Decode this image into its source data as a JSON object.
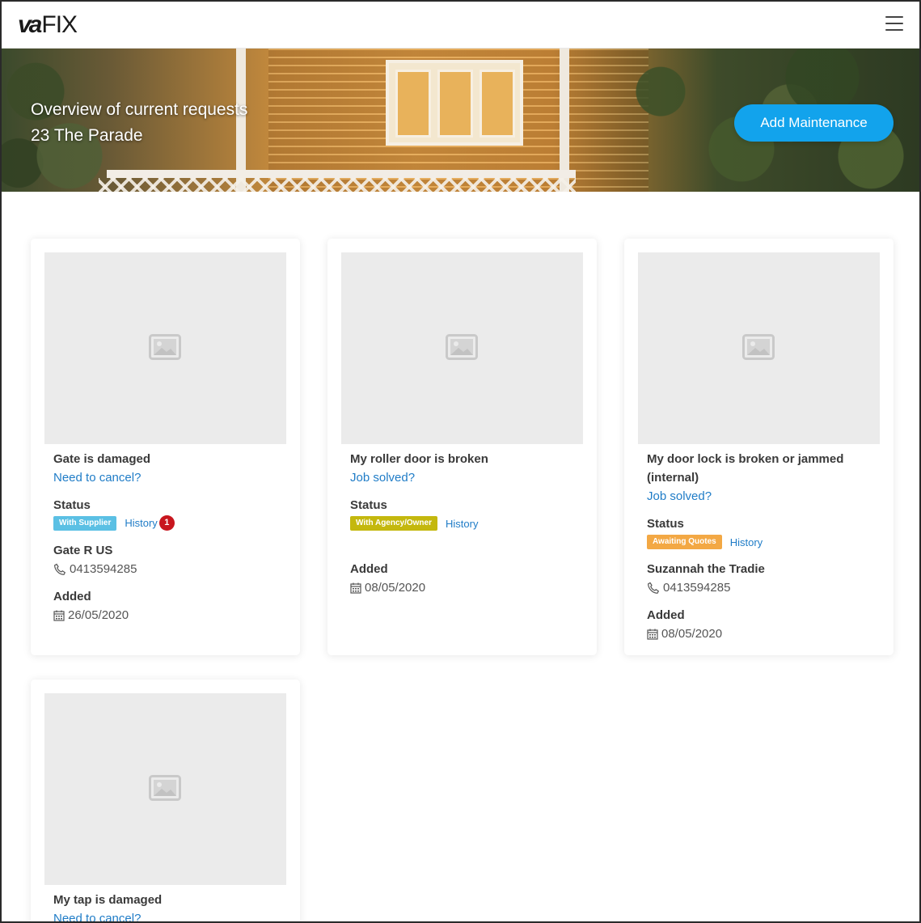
{
  "header": {
    "logo_bold": "va",
    "logo_light": "FIX",
    "menu_icon": "hamburger-icon"
  },
  "hero": {
    "title_line1": "Overview of current requests",
    "title_line2": "23 The Parade",
    "add_button_label": "Add Maintenance",
    "accent_color": "#12a3ec"
  },
  "cards": [
    {
      "title": "Gate is damaged",
      "action_link": "Need to cancel?",
      "status_label": "Status",
      "status_badge": "With Supplier",
      "status_color": "#5bc0e4",
      "history_label": "History",
      "history_count": "1",
      "supplier_name": "Gate R US",
      "phone": "0413594285",
      "added_label": "Added",
      "added_date": "26/05/2020"
    },
    {
      "title": "My roller door is broken",
      "action_link": "Job solved?",
      "status_label": "Status",
      "status_badge": "With Agency/Owner",
      "status_color": "#c4b80e",
      "history_label": "History",
      "added_label": "Added",
      "added_date": "08/05/2020"
    },
    {
      "title_line1": "My door lock is broken or jammed",
      "title_line2": "(internal)",
      "action_link": "Job solved?",
      "status_label": "Status",
      "status_badge": "Awaiting Quotes",
      "status_color": "#f3a844",
      "history_label": "History",
      "supplier_name": "Suzannah the Tradie",
      "phone": "0413594285",
      "added_label": "Added",
      "added_date": "08/05/2020"
    },
    {
      "title": "My tap is damaged",
      "action_link": "Need to cancel?"
    }
  ]
}
